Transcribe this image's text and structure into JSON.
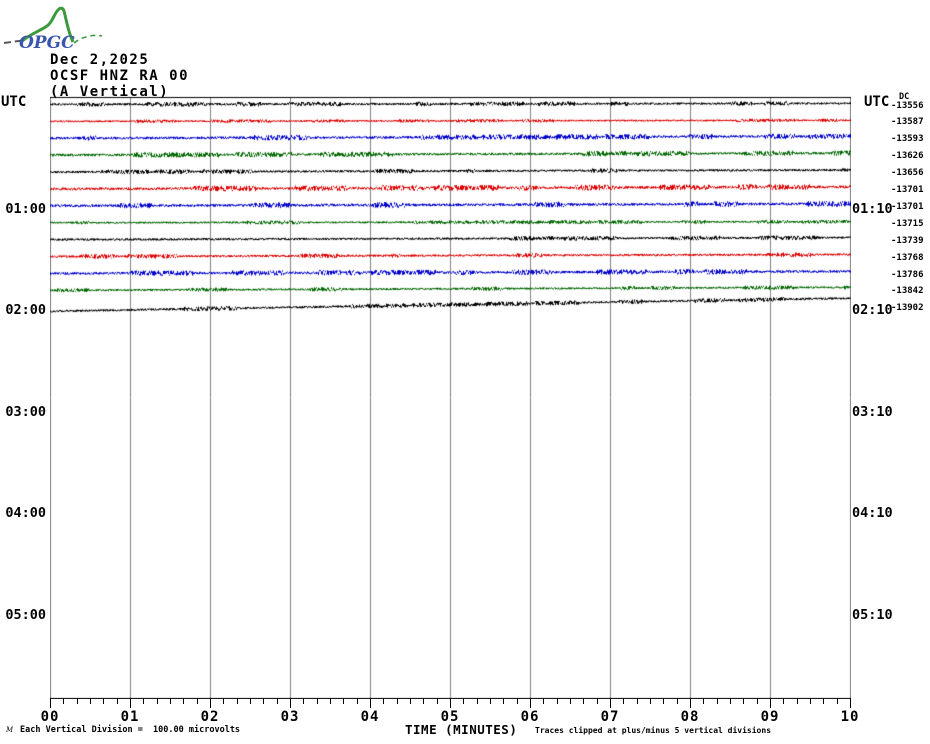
{
  "logo": {
    "text": "OPGC",
    "curve_color": "#3a9a3d",
    "text_color": "#3a55b0",
    "dash_color": "#555555"
  },
  "header": {
    "date": "Dec 2,2025",
    "station": "OCSF HNZ RA 00",
    "component": "(A Vertical)"
  },
  "axes": {
    "left_unit": "UTC",
    "right_unit": "UTC",
    "dc_label": "DC",
    "left_hour_labels": [
      {
        "text": "01:00",
        "row": 6
      },
      {
        "text": "02:00",
        "row": 12
      },
      {
        "text": "03:00",
        "row": 18
      },
      {
        "text": "04:00",
        "row": 24
      },
      {
        "text": "05:00",
        "row": 30
      }
    ],
    "right_hour_labels": [
      {
        "text": "01:10",
        "row": 6
      },
      {
        "text": "02:10",
        "row": 12
      },
      {
        "text": "03:10",
        "row": 18
      },
      {
        "text": "04:10",
        "row": 24
      },
      {
        "text": "05:10",
        "row": 30
      }
    ],
    "x_ticks": [
      "00",
      "01",
      "02",
      "03",
      "04",
      "05",
      "06",
      "07",
      "08",
      "09",
      "10"
    ],
    "x_title": "TIME (MINUTES)"
  },
  "footer": {
    "scale_note": "Each Vertical Division =  100.00 microvolts",
    "clip_note": "Traces clipped at plus/minus 5 vertical divisions",
    "corner_mark": "M"
  },
  "colors": {
    "grid": "#808080",
    "frame": "#000000"
  },
  "chart_data": {
    "type": "line",
    "kind": "helicorder-seismogram",
    "title": "OCSF HNZ RA 00 (A Vertical) Dec 2,2025",
    "xlabel": "TIME (MINUTES)",
    "xlim": [
      0,
      10
    ],
    "minutes_per_line": 10,
    "x_minor_per_major": 6,
    "rows_total": 36,
    "grid_on": true,
    "seed": 7,
    "traces": [
      {
        "start": "00:00",
        "end": "00:10",
        "dc": -13556,
        "color": "#000000",
        "row": 0,
        "amp": 1.0,
        "drift": -1,
        "offset": 0
      },
      {
        "start": "00:10",
        "end": "00:20",
        "dc": -13587,
        "color": "#dd0000",
        "row": 1,
        "amp": 0.7,
        "drift": -1,
        "offset": 0
      },
      {
        "start": "00:20",
        "end": "00:30",
        "dc": -13593,
        "color": "#0000cc",
        "row": 2,
        "amp": 1.2,
        "drift": -2,
        "offset": 0
      },
      {
        "start": "00:30",
        "end": "00:40",
        "dc": -13626,
        "color": "#006600",
        "row": 3,
        "amp": 1.2,
        "drift": -2,
        "offset": 0
      },
      {
        "start": "00:40",
        "end": "00:50",
        "dc": -13656,
        "color": "#000000",
        "row": 4,
        "amp": 1.0,
        "drift": -2,
        "offset": 0
      },
      {
        "start": "00:50",
        "end": "01:00",
        "dc": -13701,
        "color": "#dd0000",
        "row": 5,
        "amp": 1.3,
        "drift": -2,
        "offset": 0
      },
      {
        "start": "01:00",
        "end": "01:10",
        "dc": -13701,
        "color": "#0000cc",
        "row": 6,
        "amp": 1.3,
        "drift": -2,
        "offset": 0
      },
      {
        "start": "01:10",
        "end": "01:20",
        "dc": -13715,
        "color": "#006600",
        "row": 7,
        "amp": 0.8,
        "drift": -1,
        "offset": 0
      },
      {
        "start": "01:20",
        "end": "01:30",
        "dc": -13739,
        "color": "#000000",
        "row": 8,
        "amp": 1.0,
        "drift": -2,
        "offset": 0
      },
      {
        "start": "01:30",
        "end": "01:40",
        "dc": -13768,
        "color": "#dd0000",
        "row": 9,
        "amp": 1.0,
        "drift": -2,
        "offset": 0
      },
      {
        "start": "01:40",
        "end": "01:50",
        "dc": -13786,
        "color": "#0000cc",
        "row": 10,
        "amp": 1.2,
        "drift": -2,
        "offset": 0
      },
      {
        "start": "01:50",
        "end": "02:00",
        "dc": -13842,
        "color": "#006600",
        "row": 11,
        "amp": 0.9,
        "drift": -3,
        "offset": 0
      },
      {
        "start": "02:00",
        "end": "02:10",
        "dc": -13902,
        "color": "#000000",
        "row": 12,
        "amp": 1.0,
        "drift": -13,
        "offset": 4
      }
    ]
  }
}
